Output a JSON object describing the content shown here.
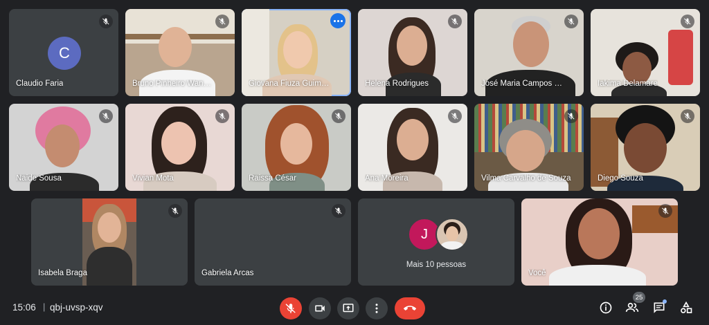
{
  "participants": [
    {
      "name": "Claudio Faria",
      "initial": "C"
    },
    {
      "name": "Bruno Pinheiro Wander…"
    },
    {
      "name": "Giovana Fiuza Guimarã…"
    },
    {
      "name": "Helena Rodrigues"
    },
    {
      "name": "José Maria Campos Li…"
    },
    {
      "name": "Iakima Delamare"
    },
    {
      "name": "Naide Sousa"
    },
    {
      "name": "Vivian Mota"
    },
    {
      "name": "Raissa César"
    },
    {
      "name": "Ana Moreira"
    },
    {
      "name": "Vilma Carvalho de Souza"
    },
    {
      "name": "Diego Souza"
    },
    {
      "name": "Isabela Braga"
    },
    {
      "name": "Gabriela Arcas"
    },
    {
      "name": "Você"
    }
  ],
  "more_tile": {
    "label": "Mais 10 pessoas",
    "initial": "J"
  },
  "bottombar": {
    "time": "15:06",
    "separator": "|",
    "meeting_code": "qbj-uvsp-xqv",
    "people_count": "25"
  },
  "colors": {
    "background": "#202124",
    "tile": "#3c4043",
    "end_call": "#ea4335",
    "active_outline": "#8ab4f8"
  }
}
